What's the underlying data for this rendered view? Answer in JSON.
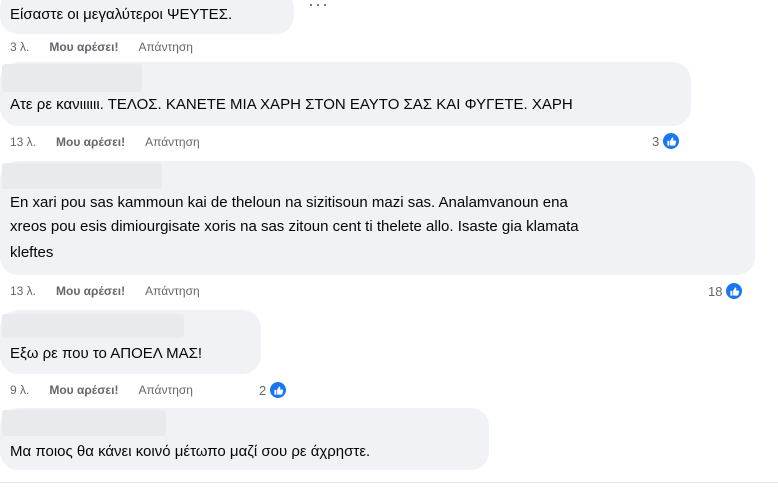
{
  "comments": [
    {
      "text": "Είσαστε οι μεγαλύτεροι ΨΕΥΤΕΣ.",
      "time": "3 λ.",
      "like_label": "Μου αρέσει!",
      "reply_label": "Απάντηση",
      "reactions": ""
    },
    {
      "text": "Ατε ρε κανιιιιιι. ΤΕΛΟΣ. ΚΑΝΕΤΕ ΜΙΑ ΧΑΡΗ ΣΤΟΝ ΕΑΥΤΟ ΣΑΣ ΚΑΙ ΦΥΓΕΤΕ. ΧΑΡΗ",
      "time": "13 λ.",
      "like_label": "Μου αρέσει!",
      "reply_label": "Απάντηση",
      "reactions": "3"
    },
    {
      "text_lines": [
        "En xari pou sas kammoun kai de theloun na sizitisoun mazi sas. Analamvanoun ena",
        "xreos pou esis dimiourgisate xoris na sas zitoun cent ti thelete allo. Isaste gia klamata",
        "kleftes"
      ],
      "time": "13 λ.",
      "like_label": "Μου αρέσει!",
      "reply_label": "Απάντηση",
      "reactions": "18"
    },
    {
      "text": "Εξω ρε που το ΑΠΟΕΛ ΜΑΣ!",
      "time": "9 λ.",
      "like_label": "Μου αρέσει!",
      "reply_label": "Απάντηση",
      "reactions": "2"
    },
    {
      "text": "Μα ποιος θα κάνει κοινό μέτωπο μαζί σου ρε άχρηστε.",
      "time": "",
      "like_label": "",
      "reply_label": "",
      "reactions": ""
    }
  ],
  "more_label": "···",
  "colors": {
    "bubble": "#f0f2f5",
    "meta_text": "#65676b",
    "like_badge": "#1877f2"
  },
  "icons": {
    "reaction": "thumbs-up-icon",
    "more": "more-options-icon"
  }
}
